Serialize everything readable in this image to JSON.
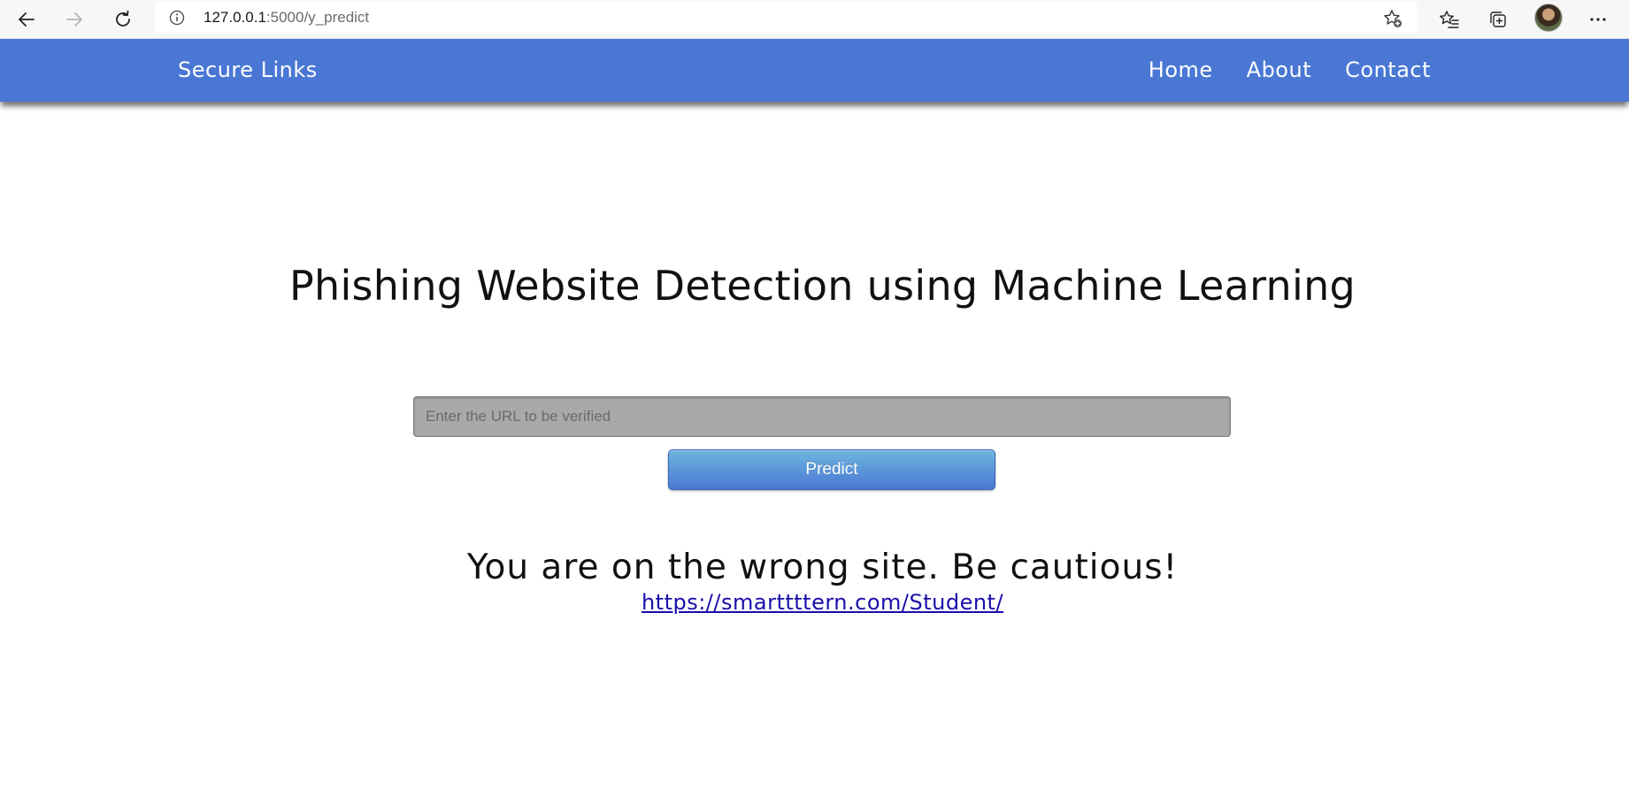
{
  "browser": {
    "url_host": "127.0.0.1",
    "url_path": ":5000/y_predict",
    "icons": [
      "back-icon",
      "forward-icon",
      "refresh-icon",
      "info-icon",
      "add-favorite-icon",
      "favorites-icon",
      "collections-icon",
      "profile-avatar",
      "more-icon"
    ]
  },
  "navbar": {
    "brand": "Secure Links",
    "links": [
      {
        "label": "Home"
      },
      {
        "label": "About"
      },
      {
        "label": "Contact"
      }
    ],
    "background_color": "#4a77d4"
  },
  "main": {
    "title": "Phishing Website Detection using Machine Learning",
    "url_input": {
      "placeholder": "Enter the URL to be verified",
      "value": ""
    },
    "predict_button": "Predict",
    "result_message": "You are on the wrong site. Be cautious!",
    "result_url": "https://smarttttern.com/Student/"
  }
}
